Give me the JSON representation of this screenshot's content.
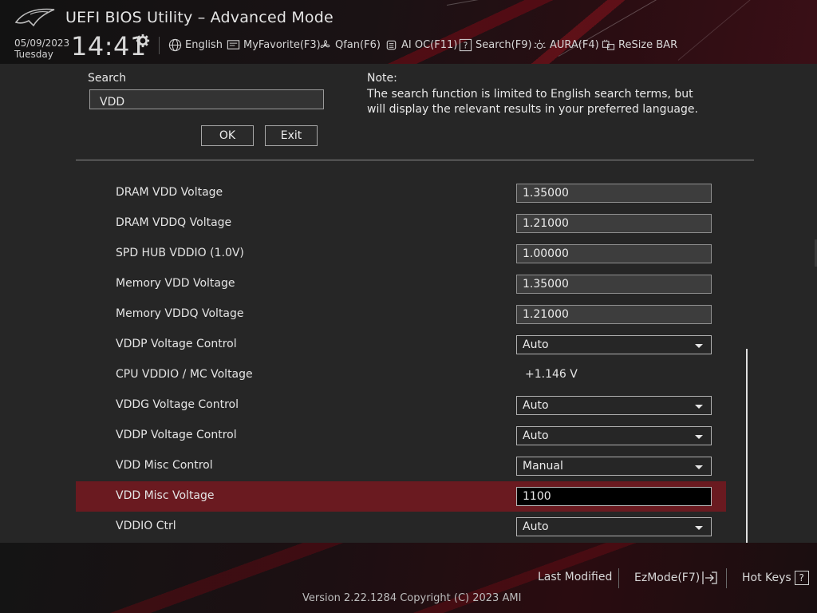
{
  "header": {
    "title": "UEFI BIOS Utility – Advanced Mode",
    "date": "05/09/2023",
    "day": "Tuesday",
    "time": "14:41",
    "nav": [
      {
        "label": "English",
        "icon": "globe-icon"
      },
      {
        "label": "MyFavorite(F3)",
        "icon": "favorite-icon"
      },
      {
        "label": "Qfan(F6)",
        "icon": "fan-icon"
      },
      {
        "label": "AI OC(F11)",
        "icon": "chip-icon"
      },
      {
        "label": "Search(F9)",
        "icon": "search-icon"
      },
      {
        "label": "AURA(F4)",
        "icon": "aura-icon"
      },
      {
        "label": "ReSize BAR",
        "icon": "resize-bar-icon"
      }
    ]
  },
  "search": {
    "label": "Search",
    "value": "VDD",
    "ok_label": "OK",
    "exit_label": "Exit",
    "note_title": "Note:",
    "note_text": "The search function is limited to English search terms, but will display the relevant results in your preferred language."
  },
  "results": [
    {
      "label": "DRAM VDD Voltage",
      "type": "field",
      "value": "1.35000"
    },
    {
      "label": "DRAM VDDQ Voltage",
      "type": "field",
      "value": "1.21000"
    },
    {
      "label": "SPD HUB VDDIO (1.0V)",
      "type": "field",
      "value": "1.00000"
    },
    {
      "label": "Memory VDD Voltage",
      "type": "field",
      "value": "1.35000"
    },
    {
      "label": "Memory VDDQ Voltage",
      "type": "field",
      "value": "1.21000"
    },
    {
      "label": "VDDP Voltage Control",
      "type": "dropdown",
      "value": "Auto"
    },
    {
      "label": "CPU VDDIO / MC Voltage",
      "type": "readout",
      "value": "+1.146 V"
    },
    {
      "label": "VDDG Voltage Control",
      "type": "dropdown",
      "value": "Auto"
    },
    {
      "label": "VDDP Voltage Control",
      "type": "dropdown",
      "value": "Auto"
    },
    {
      "label": "VDD Misc Control",
      "type": "dropdown",
      "value": "Manual"
    },
    {
      "label": "VDD Misc Voltage",
      "type": "field",
      "value": "1100",
      "selected": true
    },
    {
      "label": "VDDIO Ctrl",
      "type": "dropdown",
      "value": "Auto"
    }
  ],
  "footer": {
    "last_modified": "Last Modified",
    "ezmode": "EzMode(F7)",
    "hot_keys": "Hot Keys",
    "hot_keys_key": "?",
    "version": "Version 2.22.1284 Copyright (C) 2023 AMI"
  },
  "colors": {
    "selected_row": "#6a1a20",
    "accent": "#c8102e"
  }
}
